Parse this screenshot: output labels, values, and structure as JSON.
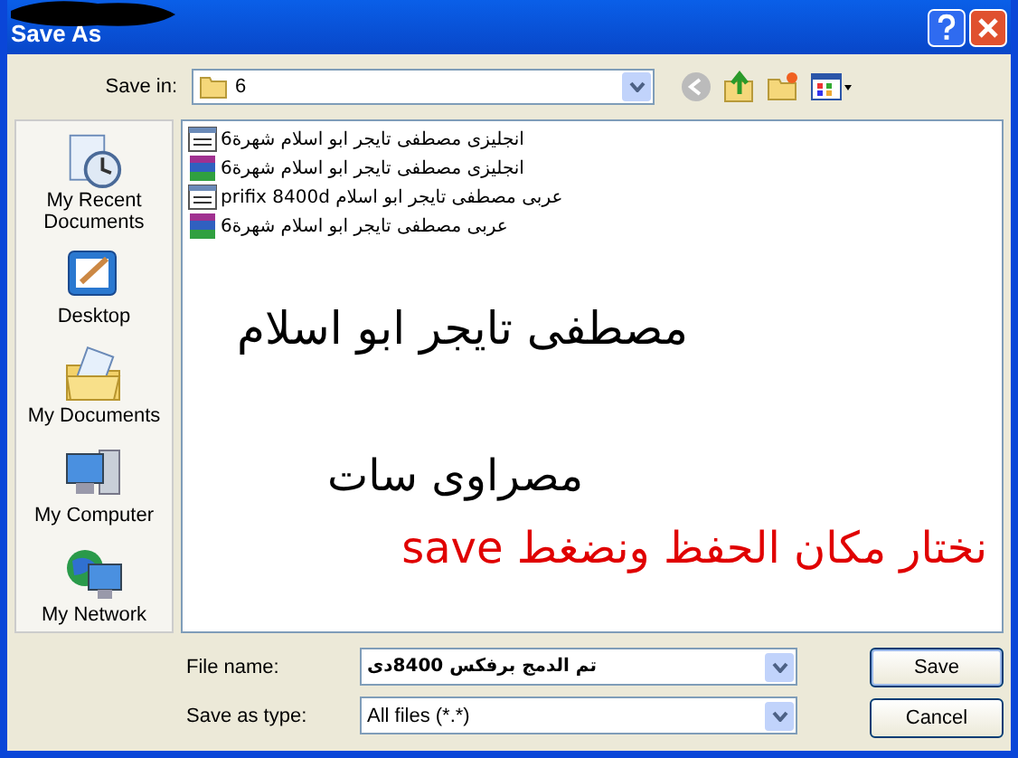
{
  "window": {
    "title": "Save As"
  },
  "save_in": {
    "label": "Save in:",
    "value": "6"
  },
  "places": [
    {
      "kind": "recent",
      "label": "My Recent Documents"
    },
    {
      "kind": "desktop",
      "label": "Desktop"
    },
    {
      "kind": "documents",
      "label": "My Documents"
    },
    {
      "kind": "computer",
      "label": "My Computer"
    },
    {
      "kind": "network",
      "label": "My Network"
    }
  ],
  "files": [
    {
      "kind": "text",
      "name": "انجليزى مصطفى تايجر ابو اسلام شهرة6"
    },
    {
      "kind": "archive",
      "name": "انجليزى مصطفى تايجر ابو اسلام شهرة6"
    },
    {
      "kind": "text",
      "name": "عربى مصطفى تايجر ابو اسلام prifix 8400d"
    },
    {
      "kind": "archive",
      "name": "عربى مصطفى تايجر ابو اسلام شهرة6"
    }
  ],
  "annotations": [
    {
      "kind": "heading",
      "text": "مصطفى تايجر ابو اسلام"
    },
    {
      "kind": "subheading",
      "text": "مصراوى سات"
    },
    {
      "kind": "instruction",
      "text": "save نختار مكان الحفظ ونضغط"
    }
  ],
  "file_name": {
    "label": "File name:",
    "value": "تم الدمج برفكس 8400دى"
  },
  "save_as_type": {
    "label": "Save as type:",
    "value": "All files (*.*)"
  },
  "buttons": [
    {
      "kind": "primary",
      "label": "Save"
    },
    {
      "kind": "normal",
      "label": "Cancel"
    }
  ]
}
